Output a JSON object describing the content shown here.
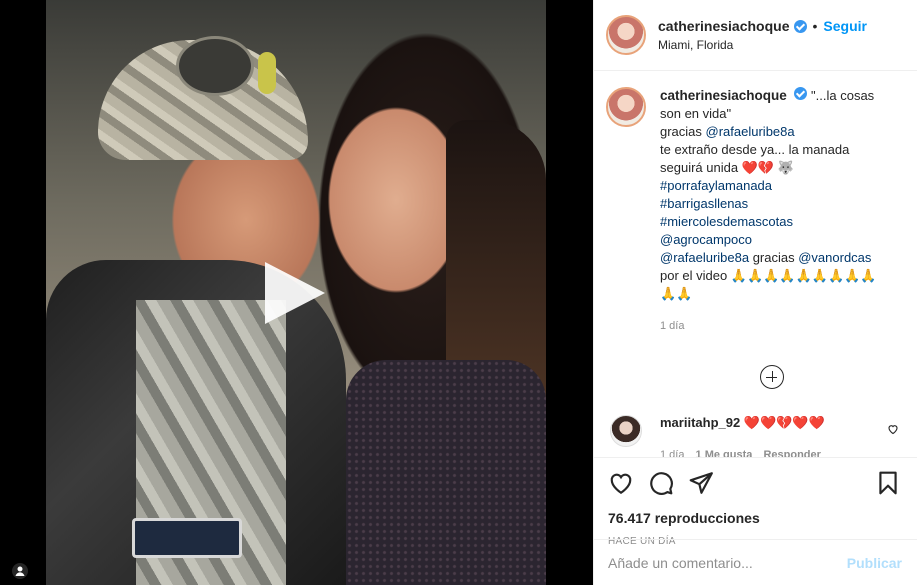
{
  "post": {
    "username": "catherinesiachoque",
    "follow_label": "Seguir",
    "separator": "•",
    "location": "Miami, Florida"
  },
  "caption": {
    "username": "catherinesiachoque",
    "line1": "\"...la cosas son en vida\"",
    "line2_prefix": "gracias ",
    "line2_mention": "@rafaeluribe8a",
    "line3": "te extraño desde ya... la manada seguirá unida",
    "line3_emoji": "❤️💔 🐺",
    "hashtags": [
      "#porrafaylamanada",
      "#barrigasllenas",
      "#miercolesdemascotas"
    ],
    "mention_agrocampo": "@agrocampoco",
    "line_final_mention1": "@rafaeluribe8a",
    "line_final_mid": " gracias ",
    "line_final_mention2": "@vanordcas",
    "line_final_suffix": "por el video",
    "line_final_emoji": "🙏🙏🙏🙏🙏🙏🙏🙏🙏🙏🙏",
    "time_ago": "1 día"
  },
  "comment": {
    "username": "mariitahp_92",
    "text": "❤️❤️💔❤️❤️",
    "time": "1 día",
    "likes": "1 Me gusta",
    "reply": "Responder"
  },
  "stats": {
    "views": "76.417 reproducciones",
    "posted": "HACE UN DÍA"
  },
  "composer": {
    "placeholder": "Añade un comentario...",
    "publish_label": "Publicar"
  },
  "icons": {
    "like": "heart-icon",
    "comment": "comment-icon",
    "share": "share-icon",
    "save": "bookmark-icon",
    "play": "play-icon",
    "more": "plus-circle-icon",
    "verified": "verified-badge-icon"
  },
  "colors": {
    "link": "#0095f6",
    "hashtag": "#00376b",
    "muted": "#8e8e8e",
    "publish_disabled": "#b2dffc",
    "verified": "#3897f0"
  }
}
